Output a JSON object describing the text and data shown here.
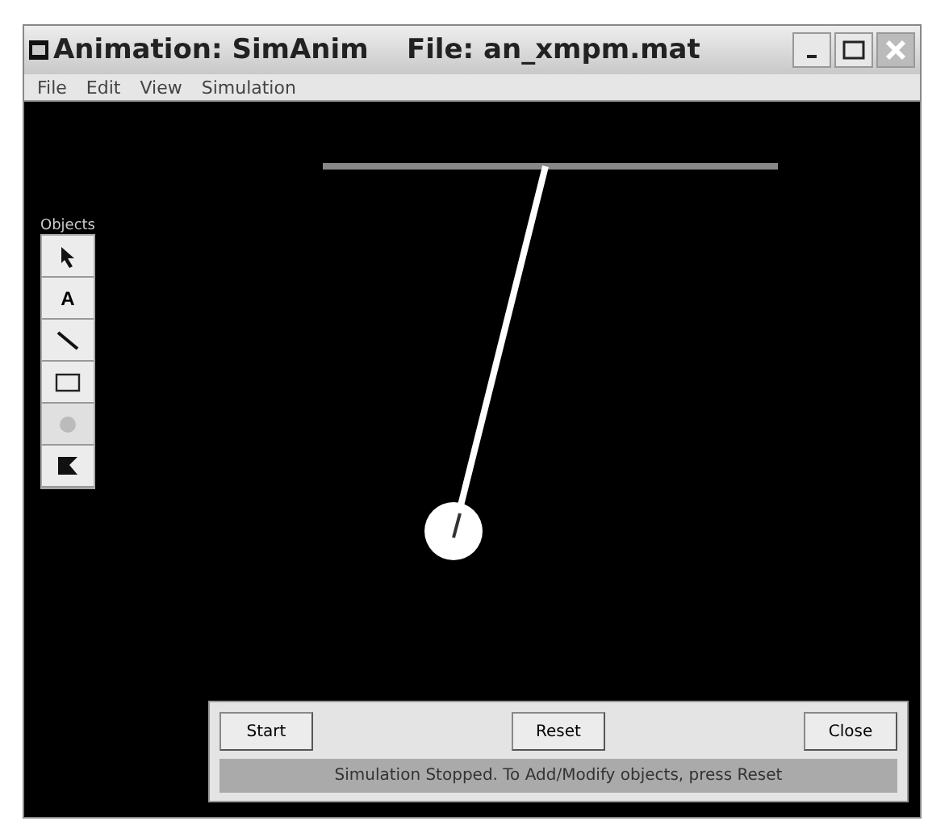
{
  "window": {
    "title": "Animation: SimAnim    File: an_xmpm.mat"
  },
  "menu": [
    "File",
    "Edit",
    "View",
    "Simulation"
  ],
  "objects_palette": {
    "label": "Objects",
    "tools": [
      {
        "kind": "pointer",
        "disabled": false
      },
      {
        "kind": "text",
        "glyph": "A",
        "disabled": false
      },
      {
        "kind": "line",
        "disabled": false
      },
      {
        "kind": "rectangle",
        "disabled": false
      },
      {
        "kind": "circle",
        "disabled": true
      },
      {
        "kind": "flag",
        "disabled": false
      }
    ]
  },
  "controls": {
    "buttons": [
      "Start",
      "Reset",
      "Close"
    ],
    "status": "Simulation Stopped. To Add/Modify objects, press Reset"
  }
}
